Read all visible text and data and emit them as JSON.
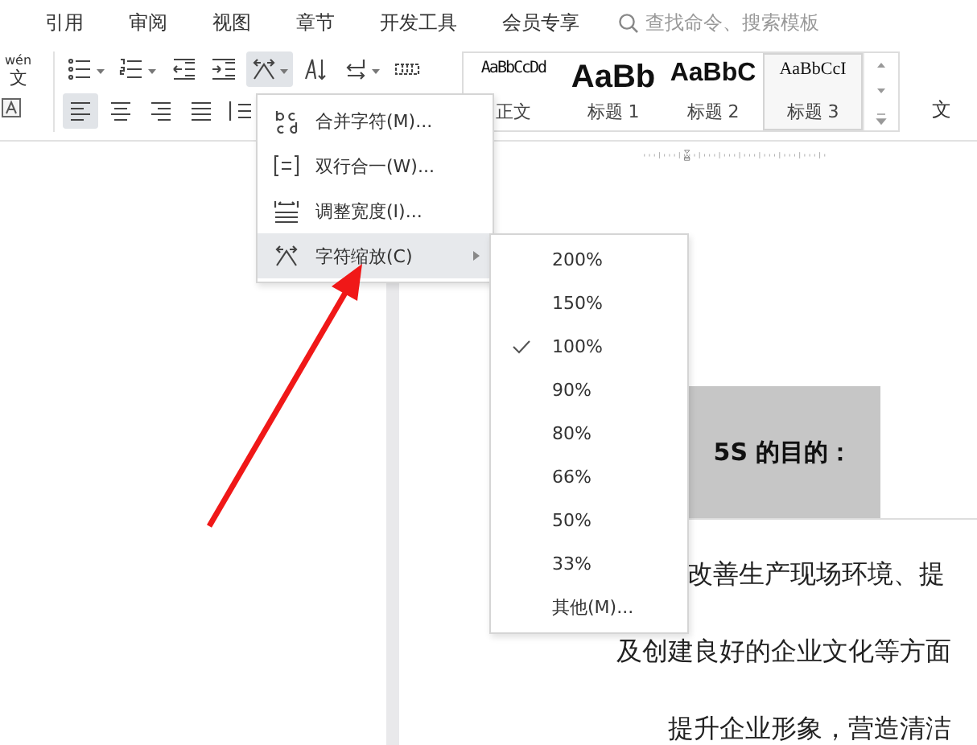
{
  "menu_tabs": [
    {
      "label": "引用"
    },
    {
      "label": "审阅"
    },
    {
      "label": "视图"
    },
    {
      "label": "章节"
    },
    {
      "label": "开发工具"
    },
    {
      "label": "会员专享"
    }
  ],
  "search": {
    "placeholder": "查找命令、搜索模板"
  },
  "pinyin": {
    "reading": "wén",
    "char": "文"
  },
  "tools_row1": [
    {
      "kind": "bullets",
      "pressed": false
    },
    {
      "kind": "numbering",
      "pressed": false
    },
    {
      "kind": "outdent",
      "pressed": false
    },
    {
      "kind": "indent",
      "pressed": false
    },
    {
      "kind": "scale",
      "pressed": true
    },
    {
      "kind": "direction",
      "pressed": false
    },
    {
      "kind": "linebreak",
      "pressed": false
    },
    {
      "kind": "table",
      "pressed": false
    }
  ],
  "tools_row2": [
    {
      "kind": "align-left",
      "pressed": true
    },
    {
      "kind": "align-center",
      "pressed": false
    },
    {
      "kind": "align-right",
      "pressed": false
    },
    {
      "kind": "justify",
      "pressed": false
    },
    {
      "kind": "distribute",
      "pressed": false
    }
  ],
  "styles": [
    {
      "sample": "AaBbCcDd",
      "label": "正文",
      "kind": "body",
      "selected": false
    },
    {
      "sample": "AaBb",
      "label": "标题 1",
      "kind": "h1",
      "selected": false
    },
    {
      "sample": "AaBbC",
      "label": "标题 2",
      "kind": "h2",
      "selected": false
    },
    {
      "sample": "AaBbCcI",
      "label": "标题 3",
      "kind": "h3",
      "selected": true
    }
  ],
  "right_label": "文",
  "format_menu": [
    {
      "label": "合并字符(M)...",
      "kind": "combine",
      "selected": false,
      "submenu": false
    },
    {
      "label": "双行合一(W)...",
      "kind": "two-lines",
      "selected": false,
      "submenu": false
    },
    {
      "label": "调整宽度(I)...",
      "kind": "width",
      "selected": false,
      "submenu": false
    },
    {
      "label": "字符缩放(C)",
      "kind": "scale",
      "selected": true,
      "submenu": true
    }
  ],
  "scale_menu": [
    {
      "label": "200%",
      "checked": false
    },
    {
      "label": "150%",
      "checked": false
    },
    {
      "label": "100%",
      "checked": true
    },
    {
      "label": "90%",
      "checked": false
    },
    {
      "label": "80%",
      "checked": false
    },
    {
      "label": "66%",
      "checked": false
    },
    {
      "label": "50%",
      "checked": false
    },
    {
      "label": "33%",
      "checked": false
    },
    {
      "label": "其他(M)...",
      "checked": false
    }
  ],
  "document": {
    "heading": "5S 的目的：",
    "lines": [
      "改善生产现场环境、提",
      "及创建良好的企业文化等方面",
      "提升企业形象，营造清洁"
    ]
  }
}
